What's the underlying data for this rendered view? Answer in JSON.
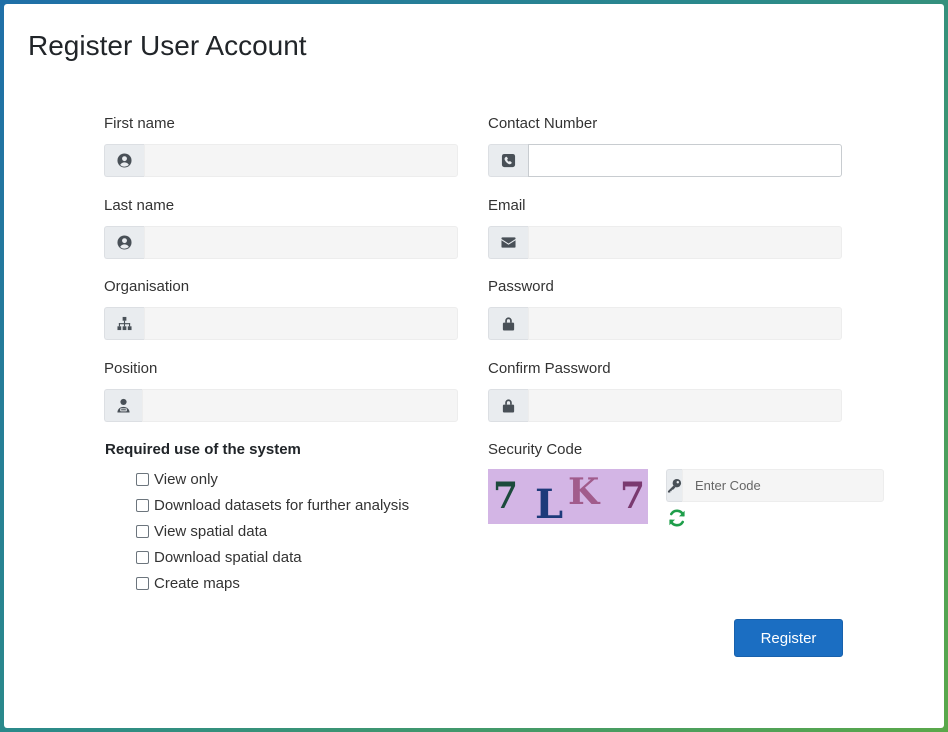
{
  "page": {
    "title": "Register User Account"
  },
  "left_fields": [
    {
      "label": "First name",
      "icon": "user-circle-icon",
      "value": ""
    },
    {
      "label": "Last name",
      "icon": "user-circle-icon",
      "value": ""
    },
    {
      "label": "Organisation",
      "icon": "sitemap-icon",
      "value": ""
    },
    {
      "label": "Position",
      "icon": "user-tie-icon",
      "value": ""
    }
  ],
  "right_fields": [
    {
      "label": "Contact Number",
      "icon": "phone-icon",
      "value": ""
    },
    {
      "label": "Email",
      "icon": "envelope-icon",
      "value": ""
    },
    {
      "label": "Password",
      "icon": "lock-icon",
      "value": ""
    },
    {
      "label": "Confirm Password",
      "icon": "lock-icon",
      "value": ""
    }
  ],
  "usage": {
    "heading": "Required use of the system",
    "options": [
      {
        "label": "View only",
        "checked": false
      },
      {
        "label": "Download datasets for further analysis",
        "checked": false
      },
      {
        "label": "View spatial data",
        "checked": false
      },
      {
        "label": "Download spatial data",
        "checked": false
      },
      {
        "label": "Create maps",
        "checked": false
      }
    ]
  },
  "security": {
    "label": "Security Code",
    "captcha_chars": [
      "7",
      "L",
      "K",
      "7"
    ],
    "code_placeholder": "Enter Code",
    "code_icon": "key-icon",
    "refresh_icon": "refresh-icon"
  },
  "actions": {
    "register_label": "Register"
  },
  "colors": {
    "primary": "#1b6ec2",
    "captcha_bg": "#d3b5e5",
    "refresh": "#1e9e4a"
  }
}
